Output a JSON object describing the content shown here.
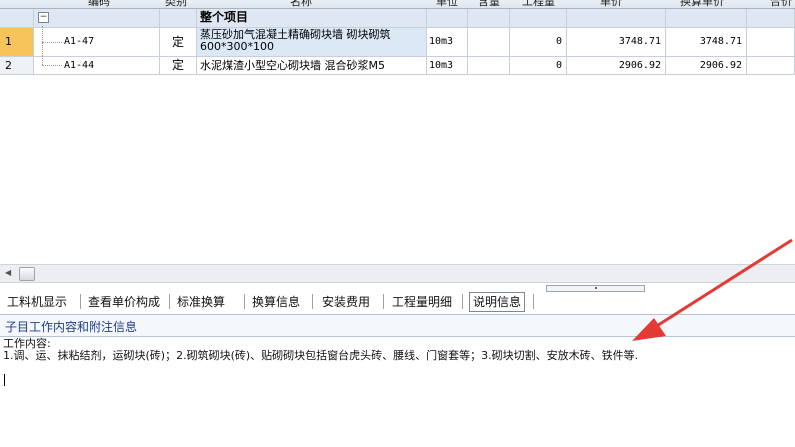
{
  "grid": {
    "headers": [
      "编码",
      "类别",
      "名称",
      "单位",
      "含量",
      "工程量",
      "单价",
      "换算单价",
      "合价"
    ],
    "group_row": {
      "title": "整个项目"
    },
    "rows": [
      {
        "num": "1",
        "code": "A1-47",
        "type": "定",
        "name": "蒸压砂加气混凝土精确砌块墙 砌块砌筑 600*300*100",
        "unit": "10m3",
        "content": "",
        "qty": "0",
        "price": "3748.71",
        "conv_price": "3748.71",
        "selected": true
      },
      {
        "num": "2",
        "code": "A1-44",
        "type": "定",
        "name": "水泥煤渣小型空心砌块墙 混合砂浆M5",
        "unit": "10m3",
        "content": "",
        "qty": "0",
        "price": "2906.92",
        "conv_price": "2906.92",
        "selected": false
      }
    ]
  },
  "tabs": [
    "工料机显示",
    "查看单价构成",
    "标准换算",
    "换算信息",
    "安装费用",
    "工程量明细",
    "说明信息"
  ],
  "active_tab": "说明信息",
  "panel": {
    "title": "子目工作内容和附注信息",
    "work_label": "工作内容:",
    "work_text": "1.调、运、抹粘结剂，运砌块(砖)；2.砌筑砌块(砖)、贴砌砌块包括窗台虎头砖、腰线、门窗套等；3.砌块切割、安放木砖、铁件等."
  },
  "colors": {
    "selection": "#f6c45b",
    "annotation_arrow": "#e53935",
    "panel_title": "#1f3f8a"
  }
}
